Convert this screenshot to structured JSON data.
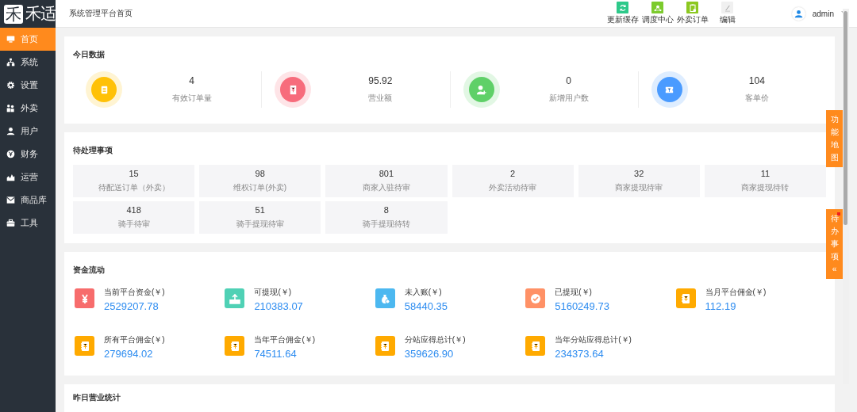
{
  "sidebar": {
    "logo_mark": "禾",
    "logo_text": "禾适",
    "items": [
      {
        "label": "首页",
        "selected": true
      },
      {
        "label": "系统",
        "selected": false
      },
      {
        "label": "设置",
        "selected": false
      },
      {
        "label": "外卖",
        "selected": false
      },
      {
        "label": "用户",
        "selected": false
      },
      {
        "label": "财务",
        "selected": false
      },
      {
        "label": "运营",
        "selected": false
      },
      {
        "label": "商品库",
        "selected": false
      },
      {
        "label": "工具",
        "selected": false
      }
    ]
  },
  "topbar": {
    "breadcrumb": "系统管理平台首页",
    "shortcuts": [
      {
        "label": "更新缓存",
        "color": "#2dc98a"
      },
      {
        "label": "调度中心",
        "color": "#7ccb2d"
      },
      {
        "label": "外卖订单",
        "color": "#8cc820"
      },
      {
        "label": "编辑",
        "color": "#f0f0f0"
      }
    ],
    "user": "admin"
  },
  "today": {
    "title": "今日数据",
    "stats": [
      {
        "value": "4",
        "label": "有效订单量",
        "color": "#ffc107"
      },
      {
        "value": "95.92",
        "label": "营业额",
        "color": "#f76c7c"
      },
      {
        "value": "0",
        "label": "新增用户数",
        "color": "#5fd068"
      },
      {
        "value": "104",
        "label": "客单价",
        "color": "#4a9bff"
      }
    ]
  },
  "pending": {
    "title": "待处理事项",
    "items": [
      {
        "value": "15",
        "label": "待配送订单（外卖）"
      },
      {
        "value": "98",
        "label": "维权订单(外卖)"
      },
      {
        "value": "801",
        "label": "商家入驻待审"
      },
      {
        "value": "2",
        "label": "外卖活动待审"
      },
      {
        "value": "32",
        "label": "商家提现待审"
      },
      {
        "value": "11",
        "label": "商家提现待转"
      },
      {
        "value": "418",
        "label": "骑手待审"
      },
      {
        "value": "51",
        "label": "骑手提现待审"
      },
      {
        "value": "8",
        "label": "骑手提现待转"
      }
    ]
  },
  "funds": {
    "title": "资金流动",
    "items": [
      {
        "label": "当前平台资金(￥)",
        "value": "2529207.78",
        "color": "#f76c6c"
      },
      {
        "label": "可提现(￥)",
        "value": "210383.07",
        "color": "#4fd1b5"
      },
      {
        "label": "未入账(￥)",
        "value": "58440.35",
        "color": "#4cb8f0"
      },
      {
        "label": "已提现(￥)",
        "value": "5160249.73",
        "color": "#ff9166"
      },
      {
        "label": "当月平台佣金(￥)",
        "value": "112.19",
        "color": "#ffaa00"
      },
      {
        "label": "所有平台佣金(￥)",
        "value": "279694.02",
        "color": "#ffaa00"
      },
      {
        "label": "当年平台佣金(￥)",
        "value": "74511.64",
        "color": "#ffaa00"
      },
      {
        "label": "分站应得总计(￥)",
        "value": "359626.90",
        "color": "#ffaa00"
      },
      {
        "label": "当年分站应得总计(￥)",
        "value": "234373.64",
        "color": "#ffaa00"
      }
    ]
  },
  "yesterday": {
    "title": "昨日营业统计"
  },
  "side_tabs": [
    {
      "label": "功能地图",
      "dot": false
    },
    {
      "label": "待办事项",
      "dot": true,
      "chevron": "«"
    }
  ]
}
